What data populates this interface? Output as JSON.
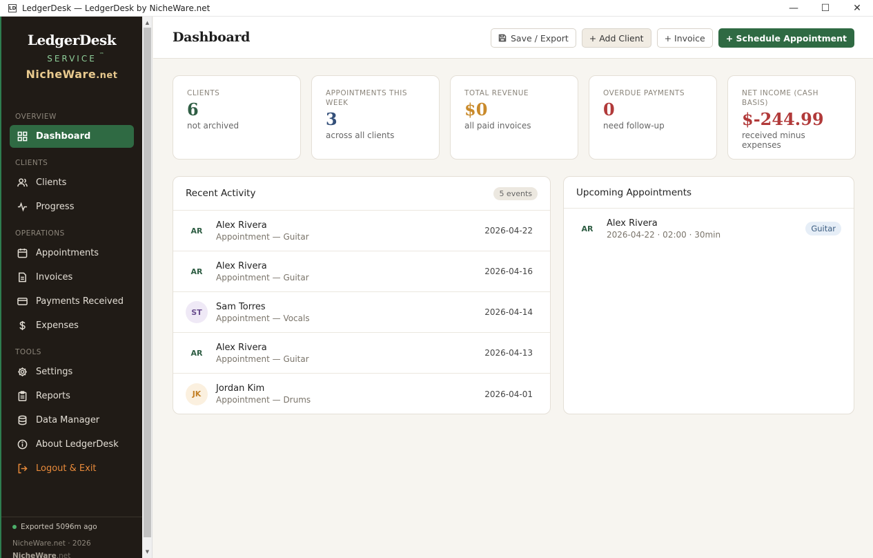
{
  "window": {
    "icon_text": "LD",
    "title": "LedgerDesk — LedgerDesk by NicheWare.net",
    "min": "—",
    "max": "☐",
    "close": "✕"
  },
  "brand": {
    "name": "LedgerDesk",
    "service": "SERVICE",
    "tm": "™",
    "niche": "NicheWare",
    "niche_net": ".net"
  },
  "nav": {
    "overview_label": "OVERVIEW",
    "dashboard": "Dashboard",
    "clients_label": "CLIENTS",
    "clients": "Clients",
    "progress": "Progress",
    "operations_label": "OPERATIONS",
    "appointments": "Appointments",
    "invoices": "Invoices",
    "payments": "Payments Received",
    "expenses": "Expenses",
    "tools_label": "TOOLS",
    "settings": "Settings",
    "reports": "Reports",
    "data_manager": "Data Manager",
    "about": "About LedgerDesk",
    "logout": "Logout & Exit"
  },
  "footer": {
    "exported": "Exported 5096m ago",
    "copyright": "NicheWare.net · 2026",
    "logo_main": "NicheWare",
    "logo_net": ".net"
  },
  "header": {
    "title": "Dashboard",
    "save_export": "Save / Export",
    "add_client": "+ Add Client",
    "invoice": "+ Invoice",
    "schedule": "+ Schedule Appointment"
  },
  "stats": [
    {
      "label": "CLIENTS",
      "value": "6",
      "sub": "not archived",
      "color": "#2f5e44"
    },
    {
      "label": "APPOINTMENTS THIS WEEK",
      "value": "3",
      "sub": "across all clients",
      "color": "#34507a"
    },
    {
      "label": "TOTAL REVENUE",
      "value": "$0",
      "sub": "all paid invoices",
      "color": "#c98a2b"
    },
    {
      "label": "OVERDUE PAYMENTS",
      "value": "0",
      "sub": "need follow-up",
      "color": "#b13a3a"
    },
    {
      "label": "NET INCOME (CASH BASIS)",
      "value": "$-244.99",
      "sub": "received minus expenses",
      "color": "#b13a3a"
    }
  ],
  "activity": {
    "title": "Recent Activity",
    "badge": "5 events",
    "rows": [
      {
        "initials": "AR",
        "name": "Alex Rivera",
        "desc": "Appointment — Guitar",
        "date": "2026-04-22",
        "bg": "#ffffff",
        "fg": "#2f5e44"
      },
      {
        "initials": "AR",
        "name": "Alex Rivera",
        "desc": "Appointment — Guitar",
        "date": "2026-04-16",
        "bg": "#ffffff",
        "fg": "#2f5e44"
      },
      {
        "initials": "ST",
        "name": "Sam Torres",
        "desc": "Appointment — Vocals",
        "date": "2026-04-14",
        "bg": "#efe9f6",
        "fg": "#6b4f8f"
      },
      {
        "initials": "AR",
        "name": "Alex Rivera",
        "desc": "Appointment — Guitar",
        "date": "2026-04-13",
        "bg": "#ffffff",
        "fg": "#2f5e44"
      },
      {
        "initials": "JK",
        "name": "Jordan Kim",
        "desc": "Appointment — Drums",
        "date": "2026-04-01",
        "bg": "#fbf0df",
        "fg": "#c27f25"
      }
    ]
  },
  "upcoming": {
    "title": "Upcoming Appointments",
    "rows": [
      {
        "initials": "AR",
        "name": "Alex Rivera",
        "desc": "2026-04-22 · 02:00 · 30min",
        "tag": "Guitar"
      }
    ]
  }
}
